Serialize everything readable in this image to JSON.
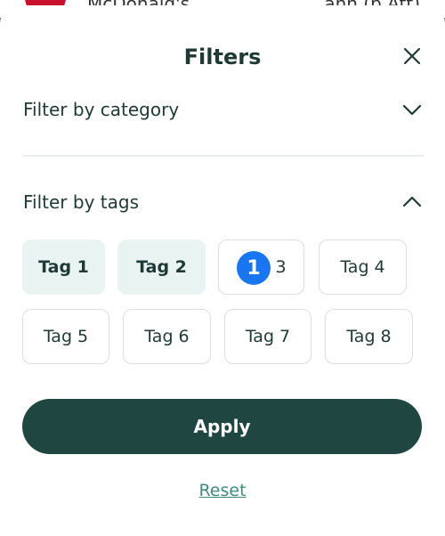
{
  "background_app": {
    "row_title": "McDonald's",
    "row_meta": "ann (b Att)"
  },
  "sheet": {
    "title": "Filters",
    "close_icon": "close-icon"
  },
  "category_section": {
    "label": "Filter by category",
    "expanded": false,
    "icon": "chevron-down-icon"
  },
  "tags_section": {
    "label": "Filter by tags",
    "expanded": true,
    "icon": "chevron-up-icon",
    "tags": [
      {
        "label": "Tag 1",
        "selected": true
      },
      {
        "label": "Tag 2",
        "selected": true
      },
      {
        "label": "3",
        "selected": false
      },
      {
        "label": "Tag 4",
        "selected": false
      },
      {
        "label": "Tag 5",
        "selected": false
      },
      {
        "label": "Tag 6",
        "selected": false
      },
      {
        "label": "Tag 7",
        "selected": false
      },
      {
        "label": "Tag 8",
        "selected": false
      }
    ]
  },
  "annotation_badge": "1",
  "actions": {
    "apply_label": "Apply",
    "reset_label": "Reset"
  },
  "colors": {
    "primary": "#1f4640",
    "selected_tag_bg": "#e9f3f1",
    "link": "#3f8c80",
    "badge": "#1876f2"
  }
}
